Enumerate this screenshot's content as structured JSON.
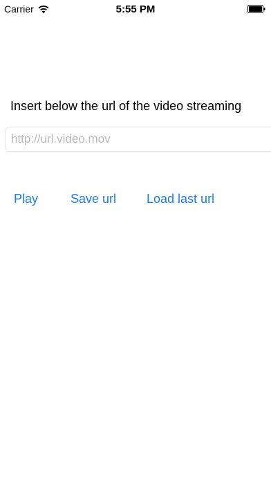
{
  "status_bar": {
    "carrier": "Carrier",
    "time": "5:55 PM",
    "icons": [
      "wifi-icon",
      "battery-icon"
    ]
  },
  "main": {
    "instruction": "Insert below the url of the video streaming",
    "url_field": {
      "value": "",
      "placeholder": "http://url.video.mov"
    },
    "buttons": {
      "play": "Play",
      "save_url": "Save url",
      "load_last_url": "Load last url"
    }
  },
  "colors": {
    "accent": "#1e7ee8",
    "background": "#ffffff",
    "placeholder": "#b7b7bd"
  }
}
